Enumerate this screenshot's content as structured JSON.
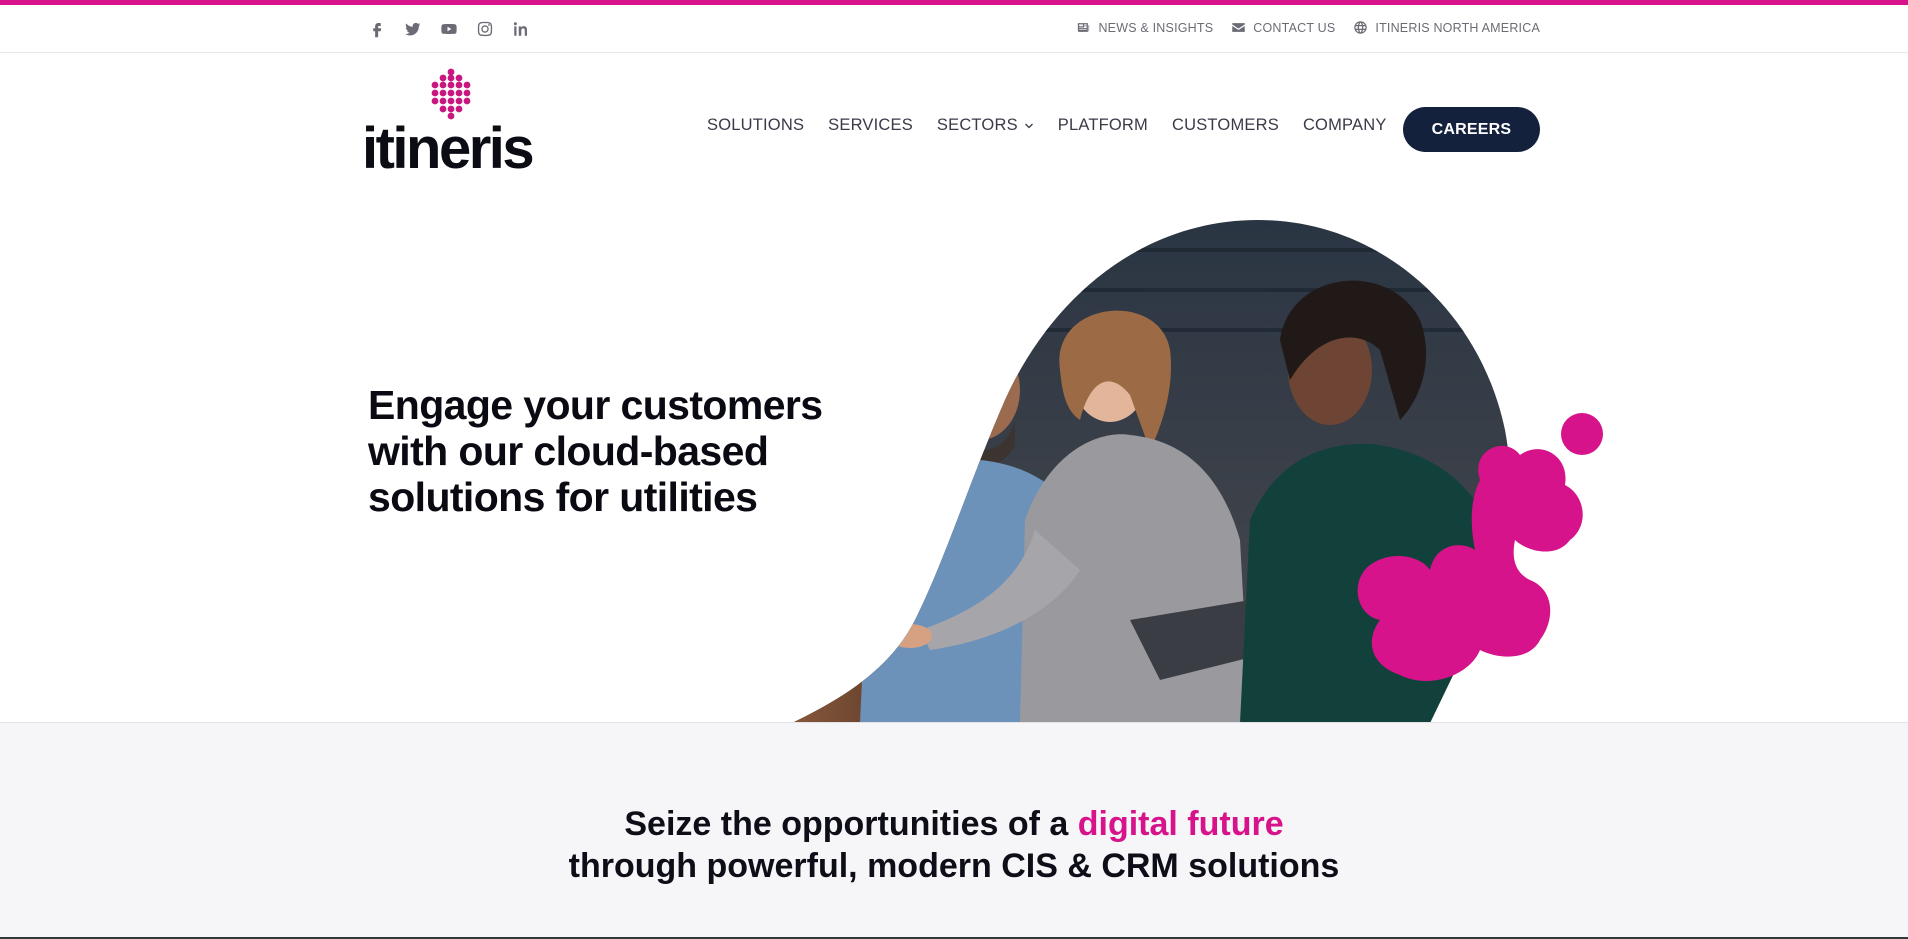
{
  "colors": {
    "accent": "#d6138a",
    "navy": "#14213d",
    "text_muted": "#6b6b75"
  },
  "social": [
    {
      "name": "facebook-icon"
    },
    {
      "name": "twitter-icon"
    },
    {
      "name": "youtube-icon"
    },
    {
      "name": "instagram-icon"
    },
    {
      "name": "linkedin-icon"
    }
  ],
  "utility": {
    "news": "NEWS & INSIGHTS",
    "contact": "CONTACT US",
    "region": "ITINERIS NORTH AMERICA"
  },
  "logo": {
    "text": "itineris"
  },
  "nav": {
    "solutions": "SOLUTIONS",
    "services": "SERVICES",
    "sectors": "SECTORS",
    "platform": "PLATFORM",
    "customers": "CUSTOMERS",
    "company": "COMPANY",
    "careers": "CAREERS"
  },
  "hero": {
    "line1": "Engage your customers",
    "line2": "with our cloud-based",
    "line3": "solutions for utilities"
  },
  "band": {
    "part1": "Seize the opportunities of a ",
    "highlight": "digital future",
    "line2": "through powerful, modern CIS & CRM solutions"
  }
}
